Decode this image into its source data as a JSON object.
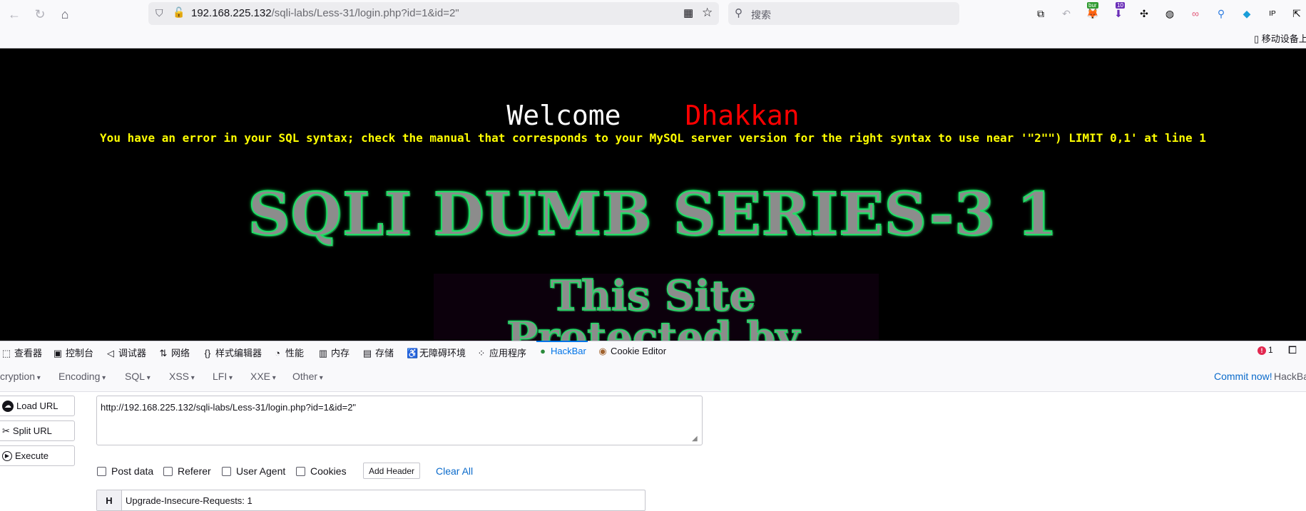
{
  "browser": {
    "url_host": "192.168.225.132",
    "url_path": "/sqli-labs/Less-31/login.php?id=1&id=2\"",
    "search_placeholder": "搜索",
    "ext_badge_burp": "bur",
    "ext_badge_count": "10",
    "bookmark_label": "移动设备上"
  },
  "page": {
    "welcome_label": "Welcome",
    "welcome_name": "Dhakkan",
    "error_text": "You have an error in your SQL syntax; check the manual that corresponds to your MySQL server version for the right syntax to use near '\"2\"\") LIMIT 0,1' at line 1",
    "title": "SQLI DUMB SERIES-3 1",
    "subtitle_line1": "This Site",
    "subtitle_line2": "Protected by"
  },
  "devtools": {
    "tabs": [
      "查看器",
      "控制台",
      "调试器",
      "网络",
      "样式编辑器",
      "性能",
      "内存",
      "存储",
      "无障碍环境",
      "应用程序",
      "HackBar",
      "Cookie Editor"
    ],
    "active_tab": "HackBar",
    "error_count": "1"
  },
  "hackbar": {
    "menu": [
      "cryption",
      "Encoding",
      "SQL",
      "XSS",
      "LFI",
      "XXE",
      "Other"
    ],
    "commit_label": "Commit now!",
    "commit_suffix": "HackBa",
    "buttons": {
      "load": "Load URL",
      "split": "Split URL",
      "execute": "Execute"
    },
    "url_value": "http://192.168.225.132/sqli-labs/Less-31/login.php?id=1&id=2\"",
    "options": {
      "post": "Post data",
      "referer": "Referer",
      "user_agent": "User Agent",
      "cookies": "Cookies"
    },
    "add_header_label": "Add Header",
    "clear_all_label": "Clear All",
    "header_badge": "H",
    "header_value": "Upgrade-Insecure-Requests: 1"
  }
}
